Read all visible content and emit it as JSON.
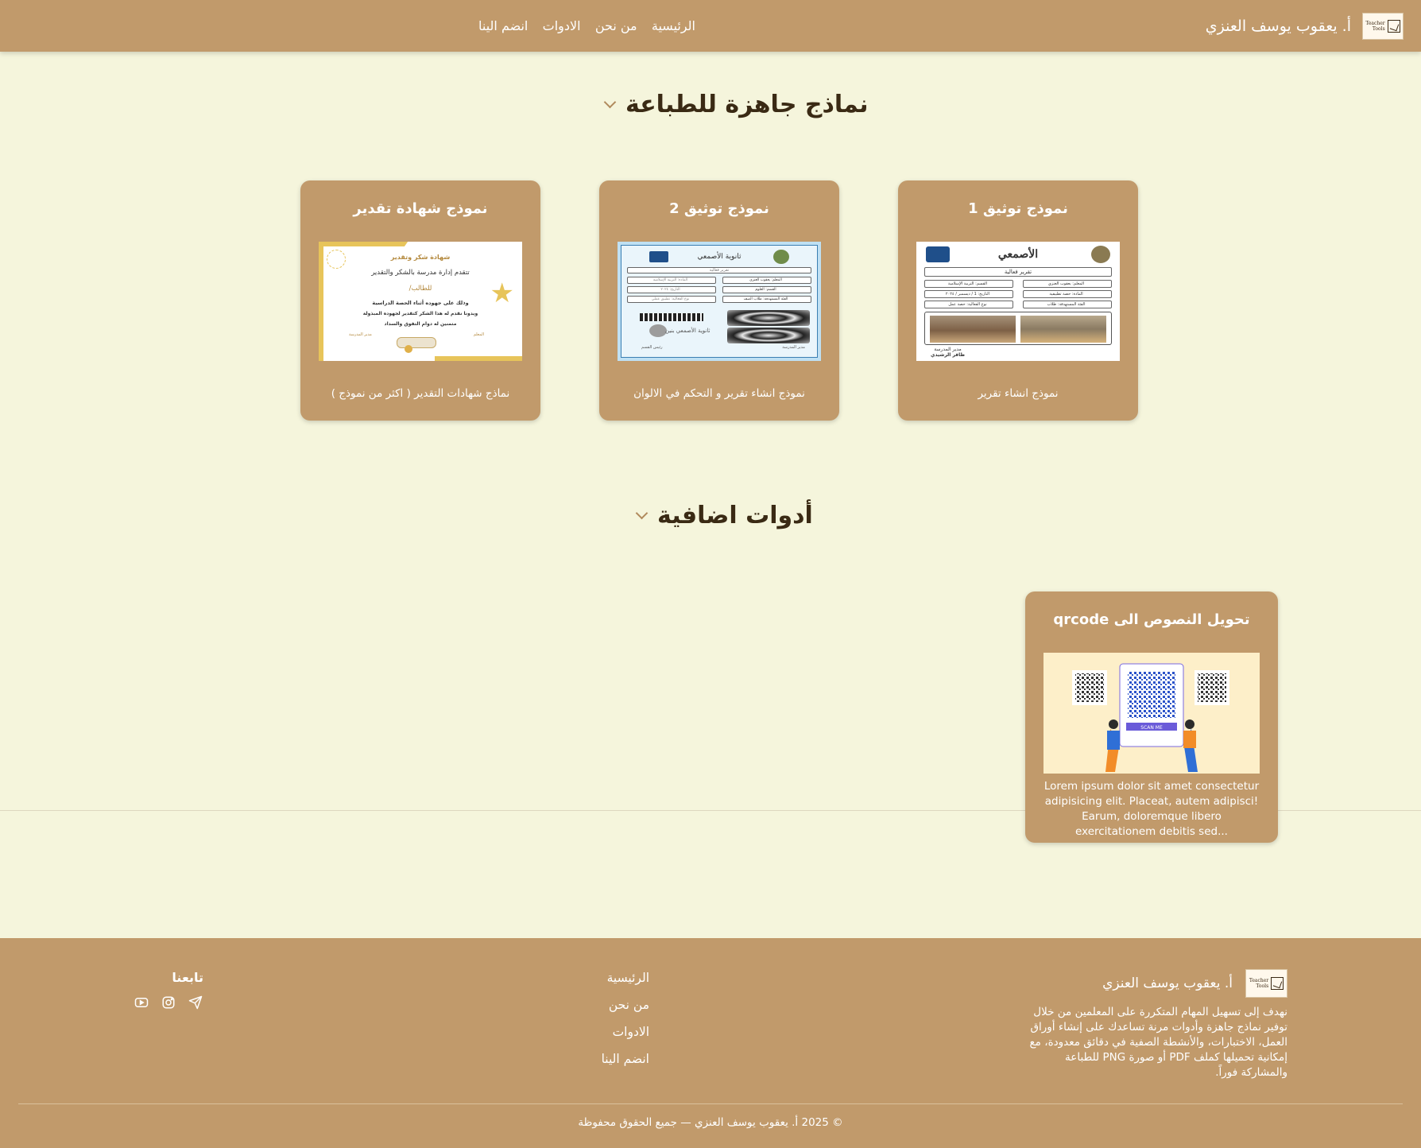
{
  "header": {
    "brand_name": "أ. يعقوب يوسف العنزي",
    "logo_text_1": "Teacher",
    "logo_text_2": "Tools",
    "nav": [
      "الرئيسية",
      "من نحن",
      "الادوات",
      "انضم الينا"
    ]
  },
  "sections": {
    "printable_title": "نماذج جاهزة للطباعة",
    "extra_tools_title": "أدوات اضافية"
  },
  "cards": [
    {
      "title": "نموذج توثيق 1",
      "description": "نموذج انشاء تقرير",
      "image": {
        "heading": "الأصمعي",
        "subheading": "تقرير فعالية",
        "rows": [
          "المعلم: يعقوب العنزي",
          "القسم: التربية الإسلامية",
          "المادة: حصة تطبيقية",
          "التاريخ: 1 / ديسمبر / ٢٠٢٤",
          "الفئة المستهدفة: طلاب",
          "نوع الفعالية: حصة عمل"
        ],
        "footer": [
          "مدير المدرسة",
          "ظافر الرشيدي"
        ]
      }
    },
    {
      "title": "نموذج توثيق 2",
      "description": "نموذج انشاء تقرير و التحكم في الالوان",
      "image": {
        "heading": "ثانوية الأصمعي",
        "subheading": "تقرير فعالية",
        "rows": [
          "المعلم: يعقوب العنزي",
          "المادة: التربية الإسلامية",
          "القسم: العلوم",
          "التاريخ: ٢٠٢٤",
          "الفئة المستهدفة: طلاب الصف",
          "نوع الفعالية: تطبيق عملي"
        ],
        "caption_1": "ثانوية الأصمعي بنين",
        "caption_2": "مدير المدرسة",
        "caption_3": "رئيس القسم"
      }
    },
    {
      "title": "نموذج شهادة تقدير",
      "description": "نماذج شهادات التقدير ( اكثر من نموذج )",
      "image": {
        "heading": "شهادة شكر وتقدير",
        "line_1": "تتقدم إدارة مدرسة بالشكر والتقدير",
        "line_2": "للطالب/",
        "line_3": "وذلك على جهوده أثناء الحصة الدراسية",
        "line_4": "ويدونا نقدم له هذا الشكر كتقدير لجهوده المبذولة",
        "line_5": "متمنين له دوام التفوق والسداد",
        "sign_right": "المعلم",
        "sign_left": "مدير المدرسة"
      }
    }
  ],
  "extra_cards": [
    {
      "title": "تحويل النصوص الى qrcode",
      "description": "Lorem ipsum dolor sit amet consectetur adipisicing elit. Placeat, autem adipisci! Earum, doloremque libero exercitationem debitis sed...",
      "image": {
        "scan_label": "SCAN ME"
      }
    }
  ],
  "footer": {
    "brand_name": "أ. يعقوب يوسف العنزي",
    "about": "نهدف إلى تسهيل المهام المتكررة على المعلمين من خلال توفير نماذج جاهزة وأدوات مرنة تساعدك على إنشاء أوراق العمل، الاختبارات، والأنشطة الصفية في دقائق معدودة، مع إمكانية تحميلها كملف PDF أو صورة PNG للطباعة والمشاركة فوراً.",
    "links": [
      "الرئيسية",
      "من نحن",
      "الادوات",
      "انضم الينا"
    ],
    "follow_title": "تابعنا",
    "icons": [
      "telegram-icon",
      "instagram-icon",
      "youtube-icon"
    ],
    "copyright": "© 2025 أ. يعقوب يوسف العنزي — جميع الحقوق محفوظة"
  },
  "colors": {
    "page_bg": "#f5f5dc",
    "primary": "#c19a6b",
    "heading_text": "#3a2a14",
    "light_text": "#ffffff"
  }
}
